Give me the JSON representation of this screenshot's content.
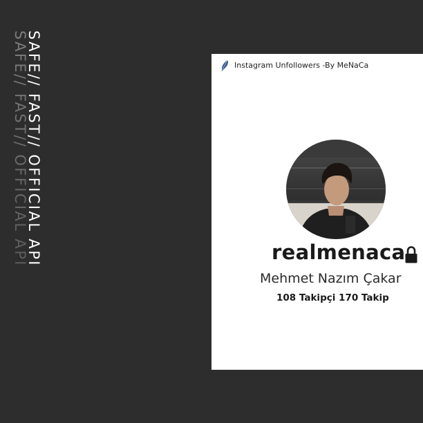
{
  "tagline": {
    "text": "SAFE// FAST// OFFICIAL API"
  },
  "window": {
    "title": "Instagram Unfollowers -By MeNaCa",
    "title_icon": "feather-icon"
  },
  "profile": {
    "username": "realmenaca",
    "private_icon": "lock-icon",
    "full_name": "Mehmet Nazım Çakar",
    "stats": "108 Takipçi 170 Takip"
  },
  "colors": {
    "background": "#2d2d2d",
    "window": "#ffffff",
    "tagline": "#ffffff",
    "text": "#1a1a1a"
  }
}
